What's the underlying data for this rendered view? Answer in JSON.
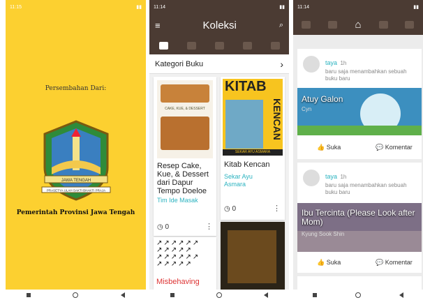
{
  "left": {
    "status_time": "11:15",
    "caption_top": "Persembahan Dari:",
    "caption_bottom": "Pemerintah Provinsi Jawa Tengah",
    "crest_band": "JAWA TENGAH",
    "crest_motto": "PRASETYA ULAH SAKTI BHAKTI PRAJA"
  },
  "mid": {
    "status_time": "11:14",
    "menu_icon": "menu-icon",
    "title": "Koleksi",
    "search_icon": "search-icon",
    "category": "Kategori Buku",
    "books": [
      {
        "title": "Resep Cake, Kue, & Dessert dari Dapur Tempo Doeloe",
        "author": "Tim Ide Masak",
        "reviews": "0",
        "cover_text": "CAKE, KUE, & DESSERT"
      },
      {
        "title": "Kitab Kencan",
        "author": "Sekar Ayu Asmara",
        "reviews": "0",
        "cover_word": "KITAB",
        "cover_side": "KENCAN",
        "cover_sub": "SEKAR AYU ASMARA"
      },
      {
        "cover_text": "Misbehaving"
      },
      {}
    ]
  },
  "right": {
    "status_time": "11:14",
    "posts": [
      {
        "user": "taya",
        "time": "1h",
        "activity": "baru saja menambahkan sebuah buku baru",
        "book_title": "Atuy Galon",
        "book_author": "Cyn",
        "like": "Suka",
        "comment": "Komentar"
      },
      {
        "user": "taya",
        "time": "1h",
        "activity": "baru saja menambahkan sebuah buku baru",
        "book_title": "Ibu Tercinta (Please Look after Mom)",
        "book_author": "Kyung Sook Shin",
        "like": "Suka",
        "comment": "Komentar"
      }
    ]
  }
}
